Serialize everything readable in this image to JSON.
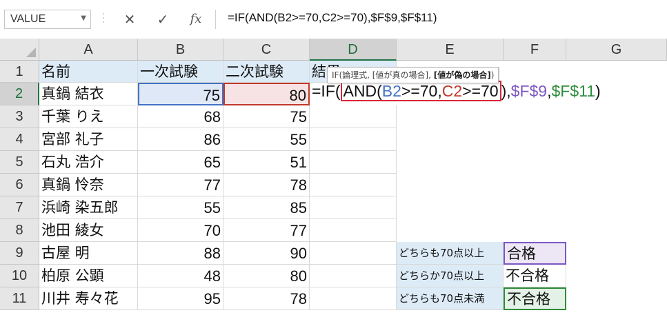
{
  "formula_bar": {
    "name_box": "VALUE",
    "cancel_icon": "✕",
    "enter_icon": "✓",
    "fx_label": "fx",
    "formula": "=IF(AND(B2>=70,C2>=70),$F$9,$F$11)"
  },
  "columns": [
    "A",
    "B",
    "C",
    "D",
    "E",
    "F",
    "G"
  ],
  "rows": [
    "1",
    "2",
    "3",
    "4",
    "5",
    "6",
    "7",
    "8",
    "9",
    "10",
    "11"
  ],
  "table": {
    "headers": [
      "名前",
      "一次試験",
      "二次試験",
      "結果"
    ],
    "records": [
      {
        "name": "真鍋 結衣",
        "first": "75",
        "second": "80"
      },
      {
        "name": "千葉 りえ",
        "first": "68",
        "second": "75"
      },
      {
        "name": "宮部 礼子",
        "first": "86",
        "second": "55"
      },
      {
        "name": "石丸 浩介",
        "first": "65",
        "second": "51"
      },
      {
        "name": "真鍋 怜奈",
        "first": "77",
        "second": "78"
      },
      {
        "name": "浜崎 染五郎",
        "first": "55",
        "second": "85"
      },
      {
        "name": "池田 綾女",
        "first": "70",
        "second": "77"
      },
      {
        "name": "古屋 明",
        "first": "88",
        "second": "90"
      },
      {
        "name": "柏原 公顕",
        "first": "48",
        "second": "80"
      },
      {
        "name": "川井 寿々花",
        "first": "95",
        "second": "78"
      }
    ]
  },
  "criteria": [
    {
      "label": "どちらも70点以上",
      "result": "合格"
    },
    {
      "label": "どちらか70点以上",
      "result": "不合格"
    },
    {
      "label": "どちらも70点未満",
      "result": "不合格"
    }
  ],
  "edit": {
    "prefix": "=IF(",
    "and_open": "AND(",
    "ref_b2": "B2",
    "cond1": ">=70,",
    "ref_c2": "C2",
    "cond2": ">=70",
    "close_paren": ")",
    "comma1": ",",
    "ref_f9": "$F$9",
    "comma2": ",",
    "ref_f11": "$F$11",
    "final_paren": ")"
  },
  "tooltip": {
    "text": "IF(論理式, [値が真の場合], ",
    "bold": "[値が偽の場合]",
    "end": ")"
  },
  "colors": {
    "ref_blue": "#4472c4",
    "ref_red": "#c0392b",
    "ref_purple": "#7b57c2",
    "ref_green": "#2e8b3a",
    "header_fill": "#ddebf7",
    "excel_green": "#217346"
  }
}
